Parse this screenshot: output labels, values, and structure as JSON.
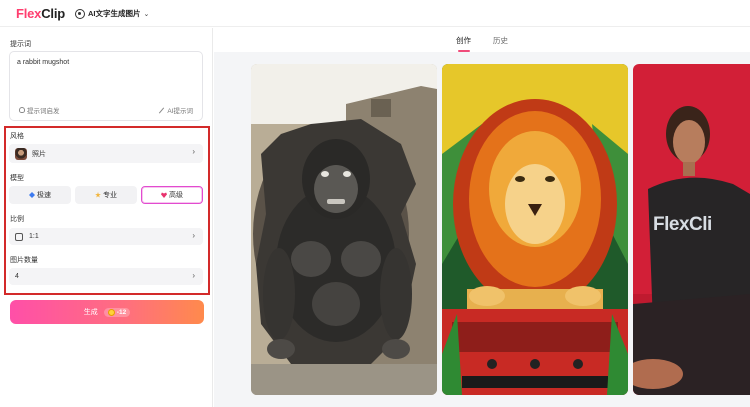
{
  "header": {
    "logo_flex": "Flex",
    "logo_clip": "Clip",
    "tool_label": "AI文字生成图片",
    "tool_chevron": "⌄"
  },
  "prompt": {
    "label": "提示词",
    "text": "a rabbit mugshot",
    "idea_label": "提示词启发",
    "ai_label": "AI提示词"
  },
  "style": {
    "label": "风格",
    "selected": "照片",
    "chevron": "›"
  },
  "model": {
    "label": "模型",
    "options": [
      "极速",
      "专业",
      "高级"
    ],
    "selected_index": 2
  },
  "ratio": {
    "label": "比例",
    "selected": "1:1",
    "chevron": "›"
  },
  "count": {
    "label": "图片数量",
    "selected": "4",
    "chevron": "›"
  },
  "generate": {
    "label": "生成",
    "cost": "-12"
  },
  "tabs": {
    "create": "创作",
    "history": "历史",
    "active": "create"
  },
  "gallery": {
    "card3_text": "FlexCli"
  },
  "colors": {
    "accent": "#f04b7a",
    "highlight_frame": "#d32a2a",
    "gradient_start": "#ff4fa8",
    "gradient_end": "#ff8a4c"
  }
}
